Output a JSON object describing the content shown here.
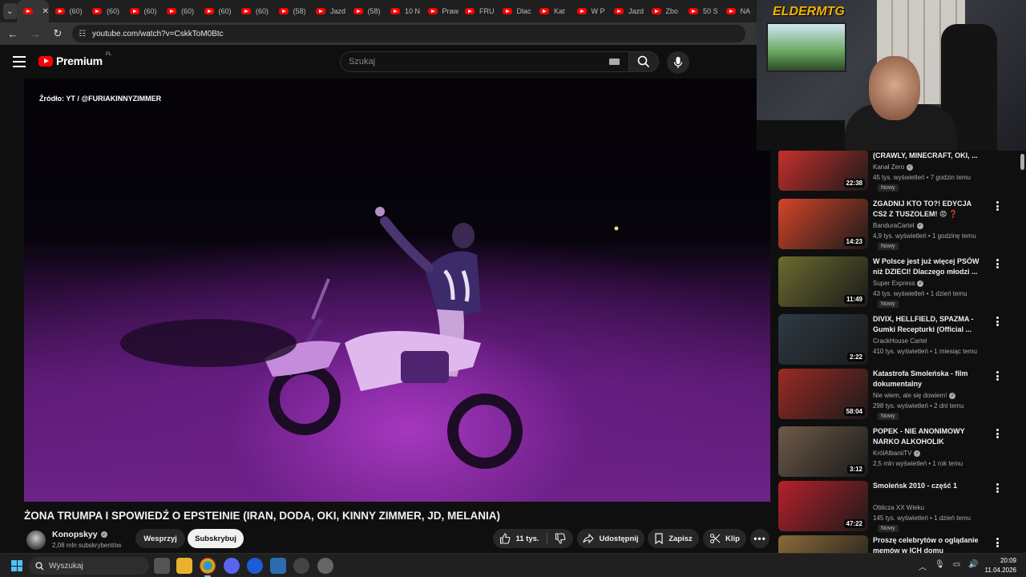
{
  "browser": {
    "tabs": [
      {
        "label": "",
        "active": true
      },
      {
        "label": "(60)"
      },
      {
        "label": "(60)"
      },
      {
        "label": "(60)"
      },
      {
        "label": "(60)"
      },
      {
        "label": "(60)"
      },
      {
        "label": "(60)"
      },
      {
        "label": "(58)"
      },
      {
        "label": "Jazd"
      },
      {
        "label": "(58)"
      },
      {
        "label": "10 N"
      },
      {
        "label": "Praw"
      },
      {
        "label": "FRU"
      },
      {
        "label": "Dlac"
      },
      {
        "label": "Kat"
      },
      {
        "label": "W P"
      },
      {
        "label": "Jazd"
      },
      {
        "label": "Zbo"
      },
      {
        "label": "50 S"
      },
      {
        "label": "NA"
      }
    ],
    "url": "youtube.com/watch?v=CskkToM0Btc"
  },
  "masthead": {
    "logo_text": "Premium",
    "logo_country": "PL",
    "search_placeholder": "Szukaj"
  },
  "video": {
    "source_caption": "Źródło: YT / @FURIAKINNYZIMMER",
    "title": "ŻONA TRUMPA I SPOWIEDŹ O EPSTEINIE (IRAN, DODA, OKI, KINNY ZIMMER, JD, MELANIA)",
    "channel_name": "Konopskyy",
    "subscribers": "2,08 mln subskrybentów",
    "support_label": "Wesprzyj",
    "subscribe_label": "Subskrybuj",
    "likes": "11 tys.",
    "share_label": "Udostępnij",
    "save_label": "Zapisz",
    "clip_label": "Klip"
  },
  "webcam": {
    "overlay_text": "ELDERMTG"
  },
  "recommendations": [
    {
      "title": "(CRAWLY, MINECRAFT, OKI, ...",
      "channel": "Kanał Zero",
      "verified": true,
      "meta": "45 tys. wyświetleń • 7 godzin temu",
      "badge": "Nowy",
      "duration": "22:38",
      "thumb_color": "#c9302c"
    },
    {
      "title": "ZGADNIJ KTO TO?! EDYCJA CS2 Z TUSZOLEM! 😡 ❓",
      "channel": "BanduraCartel",
      "verified": true,
      "meta": "4,9 tys. wyświetleń • 1 godzinę temu",
      "badge": "Nowy",
      "duration": "14:23",
      "thumb_color": "#d4452a"
    },
    {
      "title": "W Polsce jest już więcej PSÓW niż DZIECI! Dlaczego młodzi ...",
      "channel": "Super Express",
      "verified": true,
      "meta": "43 tys. wyświetleń • 1 dzień temu",
      "badge": "Nowy",
      "duration": "11:49",
      "thumb_color": "#6b6b2f"
    },
    {
      "title": "DIVIX, HELLFIELD, SPAZMA - Gumki Recepturki (Official ...",
      "channel": "CrackHouse Cartel",
      "verified": false,
      "meta": "410 tys. wyświetleń • 1 miesiąc temu",
      "badge": "",
      "duration": "2:22",
      "thumb_color": "#2e3a44"
    },
    {
      "title": "Katastrofa Smoleńska - film dokumentalny",
      "channel": "Nie wiem, ale się dowiem!",
      "verified": true,
      "meta": "298 tys. wyświetleń • 2 dni temu",
      "badge": "Nowy",
      "duration": "58:04",
      "thumb_color": "#9c2a24"
    },
    {
      "title": "POPEK - NIE ANONIMOWY NARKO ALKOHOLIK",
      "channel": "KrólAlbaniiTV",
      "verified": true,
      "meta": "2,5 mln wyświetleń • 1 rok temu",
      "badge": "",
      "duration": "3:12",
      "thumb_color": "#6e5a48"
    },
    {
      "title": "Smoleńsk 2010 - część 1",
      "channel": "Oblicza XX Wieku",
      "verified": false,
      "meta": "145 tys. wyświetleń • 1 dzień temu",
      "badge": "Nowy",
      "duration": "47:22",
      "thumb_color": "#b8202a"
    },
    {
      "title": "Proszę celebrytów o oglądanie memów w ICH domu",
      "channel": "",
      "verified": false,
      "meta": "",
      "badge": "",
      "duration": "",
      "thumb_color": "#8a6a3a"
    }
  ],
  "taskbar": {
    "search_placeholder": "Wyszukaj",
    "time": "20:09",
    "date": "11.04.2026"
  }
}
